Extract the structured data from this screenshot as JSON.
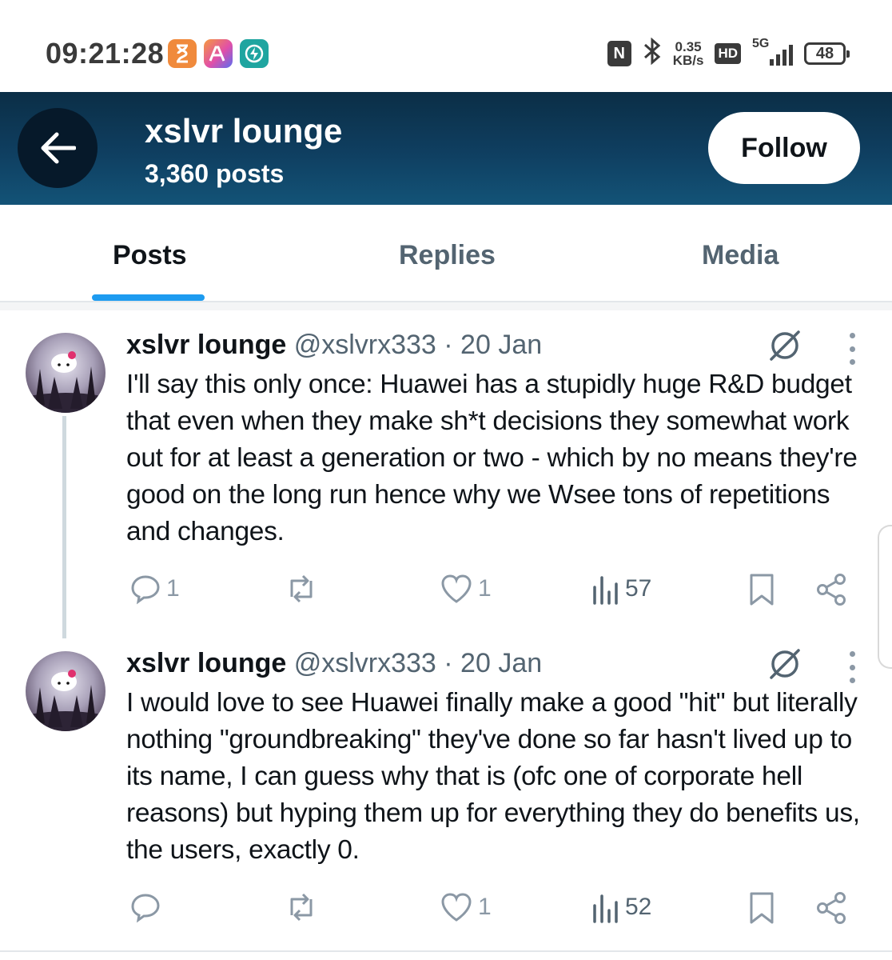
{
  "status_bar": {
    "time": "09:21:28",
    "net_speed_value": "0.35",
    "net_speed_unit": "KB/s",
    "hd": "HD",
    "network": "5G",
    "battery": "48",
    "nfc_label": "N"
  },
  "header": {
    "title": "xslvr lounge",
    "posts_count": "3,360 posts",
    "follow_label": "Follow",
    "colors": {
      "bg_top": "#0b2e46",
      "bg_bottom": "#135377"
    }
  },
  "tabs": [
    {
      "label": "Posts",
      "active": true
    },
    {
      "label": "Replies",
      "active": false
    },
    {
      "label": "Media",
      "active": false
    }
  ],
  "accent_color": "#1d9bf0",
  "posts": [
    {
      "name": "xslvr lounge",
      "meta": " @xslvrx333 · 20 Jan",
      "text": "I'll say this only once: Huawei has a stupidly huge R&D budget that even when they make sh*t decisions they somewhat work out for at least a generation or two - which by no means they're good on the long run hence why we Wsee tons of repetitions and changes.",
      "replies": "1",
      "reposts": "",
      "likes": "1",
      "views": "57"
    },
    {
      "name": "xslvr lounge",
      "meta": " @xslvrx333 · 20 Jan",
      "text": "I would love to see Huawei finally make a good \"hit\" but literally nothing \"groundbreaking\" they've done so far hasn't lived up to its name, I can guess why that is (ofc one of corporate hell reasons) but hyping them up for everything they do benefits us, the users, exactly 0.",
      "replies": "",
      "reposts": "",
      "likes": "1",
      "views": "52"
    }
  ],
  "icons": [
    "hourglass-icon",
    "ai-app-icon",
    "bolt-app-icon",
    "nfc-icon",
    "bluetooth-icon",
    "signal-icon",
    "battery-icon",
    "back-arrow-icon",
    "grok-icon",
    "more-icon",
    "reply-icon",
    "repost-icon",
    "like-icon",
    "views-icon",
    "bookmark-icon",
    "share-icon"
  ]
}
